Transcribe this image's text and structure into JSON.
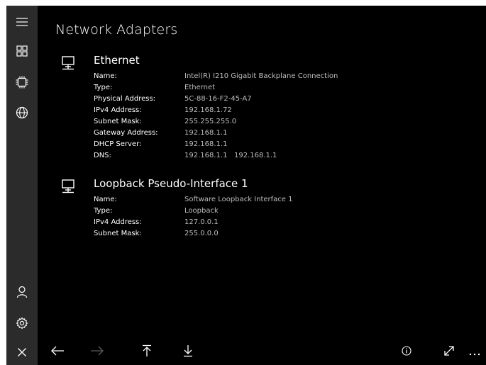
{
  "page": {
    "title": "Network Adapters"
  },
  "sidebar": {
    "items": [
      {
        "icon": "hamburger-menu-icon"
      },
      {
        "icon": "dashboard-grid-icon"
      },
      {
        "icon": "processor-chip-icon"
      },
      {
        "icon": "globe-icon"
      },
      {
        "icon": "user-icon"
      },
      {
        "icon": "gear-icon"
      },
      {
        "icon": "close-icon"
      }
    ]
  },
  "adapters": [
    {
      "name": "Ethernet",
      "icon": "network-computer-icon",
      "properties": [
        {
          "label": "Name:",
          "value": "Intel(R) I210 Gigabit Backplane Connection"
        },
        {
          "label": "Type:",
          "value": "Ethernet"
        },
        {
          "label": "Physical Address:",
          "value": "5C-88-16-F2-45-A7"
        },
        {
          "label": "IPv4 Address:",
          "value": "192.168.1.72"
        },
        {
          "label": "Subnet Mask:",
          "value": "255.255.255.0"
        },
        {
          "label": "Gateway Address:",
          "value": "192.168.1.1"
        },
        {
          "label": "DHCP Server:",
          "value": "192.168.1.1"
        },
        {
          "label": "DNS:",
          "value": "192.168.1.1   192.168.1.1"
        }
      ]
    },
    {
      "name": "Loopback Pseudo-Interface 1",
      "icon": "network-computer-icon",
      "properties": [
        {
          "label": "Name:",
          "value": "Software Loopback Interface 1"
        },
        {
          "label": "Type:",
          "value": "Loopback"
        },
        {
          "label": "IPv4 Address:",
          "value": "127.0.0.1"
        },
        {
          "label": "Subnet Mask:",
          "value": "255.0.0.0"
        }
      ]
    }
  ],
  "appbar": {
    "buttons": [
      {
        "icon": "back-arrow-icon",
        "enabled": true
      },
      {
        "icon": "forward-arrow-icon",
        "enabled": false
      },
      {
        "icon": "scroll-to-top-icon",
        "enabled": true
      },
      {
        "icon": "download-icon",
        "enabled": true
      },
      {
        "icon": "info-icon",
        "enabled": true
      },
      {
        "icon": "expand-icon",
        "enabled": true
      },
      {
        "icon": "more-ellipsis-icon",
        "enabled": true
      }
    ]
  },
  "colors": {
    "background": "#000000",
    "sidebar": "#2b2b2b",
    "text": "#ffffff",
    "value_text": "#bdbdbd",
    "disabled": "#5a5a5a"
  }
}
